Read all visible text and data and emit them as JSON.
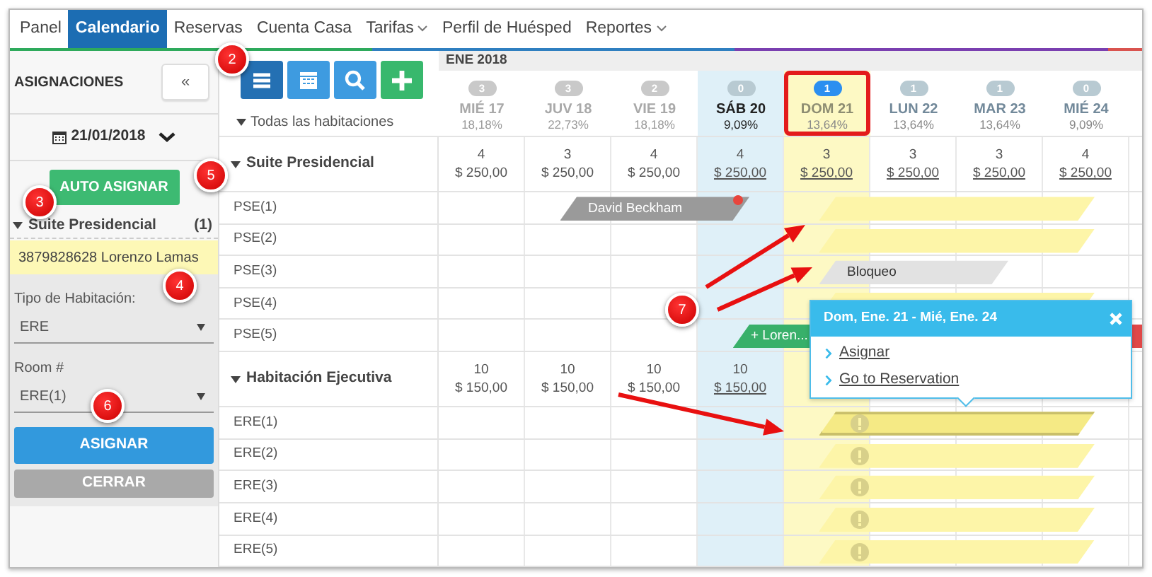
{
  "nav": [
    {
      "label": "Panel",
      "selected": false,
      "dropdown": false
    },
    {
      "label": "Calendario",
      "selected": true,
      "dropdown": false
    },
    {
      "label": "Reservas",
      "selected": false,
      "dropdown": false
    },
    {
      "label": "Cuenta Casa",
      "selected": false,
      "dropdown": false
    },
    {
      "label": "Tarifas",
      "selected": false,
      "dropdown": true
    },
    {
      "label": "Perfil de Huésped",
      "selected": false,
      "dropdown": false
    },
    {
      "label": "Reportes",
      "selected": false,
      "dropdown": true
    }
  ],
  "sidebar": {
    "title": "ASIGNACIONES",
    "collapse_button": "«",
    "date": "21/01/2018",
    "auto_button": "AUTO ASIGNAR",
    "group": {
      "name": "Suite Presidencial",
      "count": "(1)",
      "expanded": true,
      "items": [
        {
          "label": "3879828628 Lorenzo Lamas",
          "selected": true
        }
      ]
    },
    "fields": [
      {
        "label": "Tipo de Habitación:",
        "value": "ERE"
      },
      {
        "label": "Room #",
        "value": "ERE(1)"
      }
    ],
    "assign_button": "ASIGNAR",
    "close_button": {
      "label": "CERRAR",
      "disabled": true
    }
  },
  "toolbar": [
    {
      "kind": "list",
      "selected": true
    },
    {
      "kind": "calendar",
      "selected": false
    },
    {
      "kind": "search",
      "selected": false
    },
    {
      "kind": "add",
      "selected": false
    }
  ],
  "room_filter": "Todas las habitaciones",
  "calendar": {
    "month": "ENE 2018",
    "days": [
      {
        "label": "MIÉ 17",
        "count": "3",
        "occupancy": "18,18%",
        "past": true,
        "today": false,
        "selected": false
      },
      {
        "label": "JUV 18",
        "count": "3",
        "occupancy": "22,73%",
        "past": true,
        "today": false,
        "selected": false
      },
      {
        "label": "VIE 19",
        "count": "2",
        "occupancy": "18,18%",
        "past": true,
        "today": false,
        "selected": false
      },
      {
        "label": "SÁB 20",
        "count": "0",
        "occupancy": "9,09%",
        "past": false,
        "today": true,
        "selected": false
      },
      {
        "label": "DOM 21",
        "count": "1",
        "occupancy": "13,64%",
        "past": false,
        "today": false,
        "selected": true
      },
      {
        "label": "LUN 22",
        "count": "1",
        "occupancy": "13,64%",
        "past": false,
        "today": false,
        "selected": false
      },
      {
        "label": "MAR 23",
        "count": "1",
        "occupancy": "13,64%",
        "past": false,
        "today": false,
        "selected": false
      },
      {
        "label": "MIÉ 24",
        "count": "0",
        "occupancy": "9,09%",
        "past": false,
        "today": false,
        "selected": false
      }
    ],
    "groups": [
      {
        "name": "Suite Presidencial",
        "expanded": true,
        "availability": [
          {
            "count": "4",
            "price": "$ 250,00",
            "linked": false
          },
          {
            "count": "3",
            "price": "$ 250,00",
            "linked": false
          },
          {
            "count": "4",
            "price": "$ 250,00",
            "linked": false
          },
          {
            "count": "4",
            "price": "$ 250,00",
            "linked": true
          },
          {
            "count": "3",
            "price": "$ 250,00",
            "linked": true
          },
          {
            "count": "3",
            "price": "$ 250,00",
            "linked": true
          },
          {
            "count": "3",
            "price": "$ 250,00",
            "linked": true
          },
          {
            "count": "4",
            "price": "$ 250,00",
            "linked": true
          }
        ],
        "rooms": [
          {
            "name": "PSE(1)",
            "bookings": [
              {
                "kind": "guest",
                "label": "David Beckham",
                "selected": false
              },
              {
                "kind": "unassigned",
                "selected": false
              }
            ]
          },
          {
            "name": "PSE(2)",
            "bookings": [
              {
                "kind": "unassigned",
                "selected": false
              }
            ]
          },
          {
            "name": "PSE(3)",
            "bookings": [
              {
                "kind": "block",
                "label": "Bloqueo",
                "selected": false
              }
            ]
          },
          {
            "name": "PSE(4)",
            "bookings": [
              {
                "kind": "unassigned",
                "selected": false
              }
            ]
          },
          {
            "name": "PSE(5)",
            "bookings": [
              {
                "kind": "new",
                "label": "+ Loren...",
                "selected": false
              },
              {
                "kind": "other",
                "selected": false
              }
            ]
          }
        ]
      },
      {
        "name": "Habitación Ejecutiva",
        "expanded": true,
        "availability": [
          {
            "count": "10",
            "price": "$ 150,00",
            "linked": false
          },
          {
            "count": "10",
            "price": "$ 150,00",
            "linked": false
          },
          {
            "count": "10",
            "price": "$ 150,00",
            "linked": false
          },
          {
            "count": "10",
            "price": "$ 150,00",
            "linked": true
          }
        ],
        "rooms": [
          {
            "name": "ERE(1)",
            "bookings": [
              {
                "kind": "alert",
                "selected": true
              }
            ]
          },
          {
            "name": "ERE(2)",
            "bookings": [
              {
                "kind": "alert",
                "selected": false
              }
            ]
          },
          {
            "name": "ERE(3)",
            "bookings": [
              {
                "kind": "alert",
                "selected": false
              }
            ]
          },
          {
            "name": "ERE(4)",
            "bookings": [
              {
                "kind": "alert",
                "selected": false
              }
            ]
          },
          {
            "name": "ERE(5)",
            "bookings": [
              {
                "kind": "alert",
                "selected": false
              }
            ]
          }
        ]
      }
    ]
  },
  "popover": {
    "title": "Dom, Ene. 21 - Mié, Ene. 24",
    "links": [
      "Asignar",
      "Go to Reservation"
    ]
  },
  "callouts": [
    {
      "label": "2"
    },
    {
      "label": "3"
    },
    {
      "label": "4"
    },
    {
      "label": "5"
    },
    {
      "label": "6"
    },
    {
      "label": "7"
    }
  ]
}
